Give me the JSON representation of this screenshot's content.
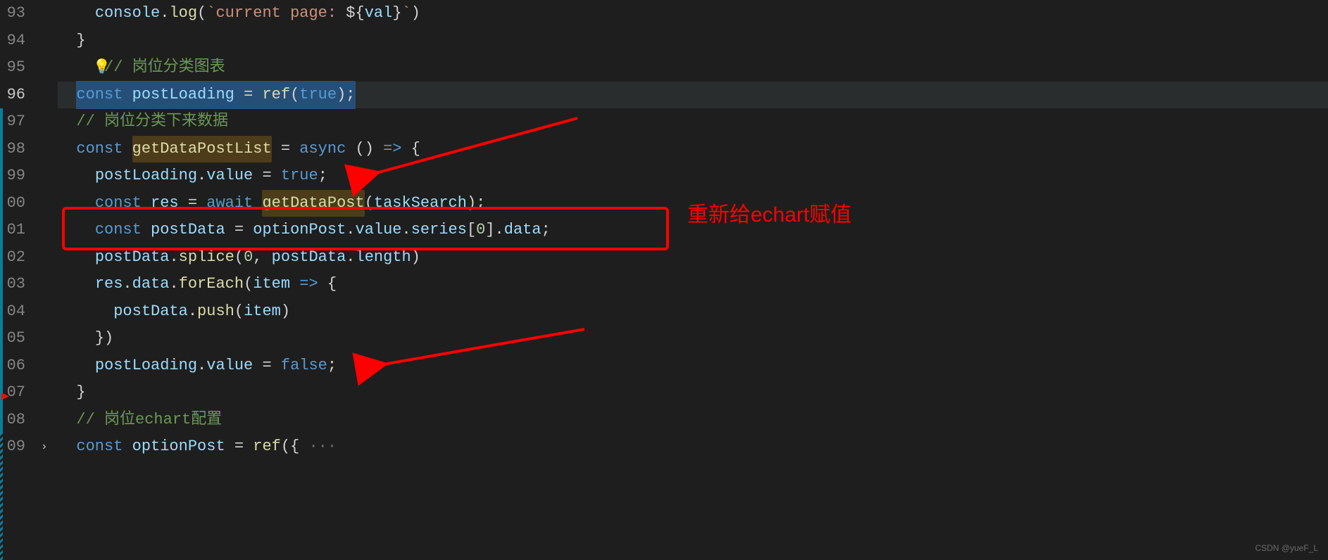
{
  "line_numbers": [
    "93",
    "94",
    "95",
    "96",
    "97",
    "98",
    "99",
    "00",
    "01",
    "02",
    "03",
    "04",
    "05",
    "06",
    "07",
    "08",
    "09"
  ],
  "active_line_index": 3,
  "bulb_line_index": 2,
  "fold_line_index": 16,
  "breakpoint_caret_line_index": 14,
  "code": {
    "l93": {
      "indent": "    ",
      "tokens": [
        {
          "t": "console",
          "c": "tk-var"
        },
        {
          "t": ".",
          "c": "tk-pun"
        },
        {
          "t": "log",
          "c": "tk-call"
        },
        {
          "t": "(",
          "c": "tk-pun"
        },
        {
          "t": "`current page: ",
          "c": "tk-str"
        },
        {
          "t": "${",
          "c": "tk-pun"
        },
        {
          "t": "val",
          "c": "tk-var"
        },
        {
          "t": "}",
          "c": "tk-pun"
        },
        {
          "t": "`",
          "c": "tk-str"
        },
        {
          "t": ")",
          "c": "tk-pun"
        }
      ]
    },
    "l94": {
      "indent": "  ",
      "tokens": [
        {
          "t": "}",
          "c": "tk-pun"
        }
      ]
    },
    "l95": {
      "indent": "  ",
      "tokens": [
        {
          "t": "// 岗位分类图表",
          "c": "tk-cmt"
        }
      ]
    },
    "l96_raw": "const postLoading = ref(true);",
    "l97": {
      "indent": "  ",
      "tokens": [
        {
          "t": "// 岗位分类下来数据",
          "c": "tk-cmt"
        }
      ]
    },
    "l98": {
      "indent": "  ",
      "tokens": [
        {
          "t": "const ",
          "c": "tk-kw"
        },
        {
          "t": "getDataPostList",
          "c": "tk-call ref-hl"
        },
        {
          "t": " = ",
          "c": "tk-op"
        },
        {
          "t": "async",
          "c": "tk-kw"
        },
        {
          "t": " () ",
          "c": "tk-pun"
        },
        {
          "t": "=>",
          "c": "tk-kw"
        },
        {
          "t": " {",
          "c": "tk-pun"
        }
      ]
    },
    "l99": {
      "indent": "    ",
      "tokens": [
        {
          "t": "postLoading",
          "c": "tk-var"
        },
        {
          "t": ".",
          "c": "tk-pun"
        },
        {
          "t": "value",
          "c": "tk-prop"
        },
        {
          "t": " = ",
          "c": "tk-op"
        },
        {
          "t": "true",
          "c": "tk-const"
        },
        {
          "t": ";",
          "c": "tk-pun"
        }
      ]
    },
    "l00": {
      "indent": "    ",
      "tokens": [
        {
          "t": "const ",
          "c": "tk-kw"
        },
        {
          "t": "res",
          "c": "tk-var"
        },
        {
          "t": " = ",
          "c": "tk-op"
        },
        {
          "t": "await ",
          "c": "tk-kw"
        },
        {
          "t": "getDataPost",
          "c": "tk-call ref-hl"
        },
        {
          "t": "(",
          "c": "tk-pun"
        },
        {
          "t": "taskSearch",
          "c": "tk-var"
        },
        {
          "t": ");",
          "c": "tk-pun"
        }
      ]
    },
    "l01": {
      "indent": "    ",
      "tokens": [
        {
          "t": "const ",
          "c": "tk-kw"
        },
        {
          "t": "postData",
          "c": "tk-var"
        },
        {
          "t": " = ",
          "c": "tk-op"
        },
        {
          "t": "optionPost",
          "c": "tk-var"
        },
        {
          "t": ".",
          "c": "tk-pun"
        },
        {
          "t": "value",
          "c": "tk-prop"
        },
        {
          "t": ".",
          "c": "tk-pun"
        },
        {
          "t": "series",
          "c": "tk-prop"
        },
        {
          "t": "[",
          "c": "tk-pun"
        },
        {
          "t": "0",
          "c": "tk-index"
        },
        {
          "t": "].",
          "c": "tk-pun"
        },
        {
          "t": "data",
          "c": "tk-prop"
        },
        {
          "t": ";",
          "c": "tk-pun"
        }
      ]
    },
    "l02": {
      "indent": "    ",
      "tokens": [
        {
          "t": "postData",
          "c": "tk-var"
        },
        {
          "t": ".",
          "c": "tk-pun"
        },
        {
          "t": "splice",
          "c": "tk-call"
        },
        {
          "t": "(",
          "c": "tk-pun"
        },
        {
          "t": "0",
          "c": "tk-num"
        },
        {
          "t": ", ",
          "c": "tk-pun"
        },
        {
          "t": "postData",
          "c": "tk-var"
        },
        {
          "t": ".",
          "c": "tk-pun"
        },
        {
          "t": "length",
          "c": "tk-prop"
        },
        {
          "t": ")",
          "c": "tk-pun"
        }
      ]
    },
    "l03": {
      "indent": "    ",
      "tokens": [
        {
          "t": "res",
          "c": "tk-var"
        },
        {
          "t": ".",
          "c": "tk-pun"
        },
        {
          "t": "data",
          "c": "tk-prop"
        },
        {
          "t": ".",
          "c": "tk-pun"
        },
        {
          "t": "forEach",
          "c": "tk-call"
        },
        {
          "t": "(",
          "c": "tk-pun"
        },
        {
          "t": "item",
          "c": "tk-param"
        },
        {
          "t": " => ",
          "c": "tk-kw"
        },
        {
          "t": "{",
          "c": "tk-pun"
        }
      ]
    },
    "l04": {
      "indent": "      ",
      "tokens": [
        {
          "t": "postData",
          "c": "tk-var"
        },
        {
          "t": ".",
          "c": "tk-pun"
        },
        {
          "t": "push",
          "c": "tk-call"
        },
        {
          "t": "(",
          "c": "tk-pun"
        },
        {
          "t": "item",
          "c": "tk-var"
        },
        {
          "t": ")",
          "c": "tk-pun"
        }
      ]
    },
    "l05": {
      "indent": "    ",
      "tokens": [
        {
          "t": "})",
          "c": "tk-pun"
        }
      ]
    },
    "l06": {
      "indent": "    ",
      "tokens": [
        {
          "t": "postLoading",
          "c": "tk-var"
        },
        {
          "t": ".",
          "c": "tk-pun"
        },
        {
          "t": "value",
          "c": "tk-prop"
        },
        {
          "t": " = ",
          "c": "tk-op"
        },
        {
          "t": "false",
          "c": "tk-const"
        },
        {
          "t": ";",
          "c": "tk-pun"
        }
      ]
    },
    "l07": {
      "indent": "  ",
      "tokens": [
        {
          "t": "}",
          "c": "tk-pun"
        }
      ]
    },
    "l08": {
      "indent": "  ",
      "tokens": [
        {
          "t": "// 岗位echart配置",
          "c": "tk-cmt"
        }
      ]
    },
    "l09": {
      "indent": "  ",
      "tokens": [
        {
          "t": "const ",
          "c": "tk-kw"
        },
        {
          "t": "optionPost",
          "c": "tk-var"
        },
        {
          "t": " = ",
          "c": "tk-op"
        },
        {
          "t": "ref",
          "c": "tk-call"
        },
        {
          "t": "({",
          "c": "tk-pun"
        },
        {
          "t": " ···",
          "c": "tk-dots"
        }
      ]
    }
  },
  "annotation": {
    "label": "重新给echart赋值"
  },
  "watermark": "CSDN @yueF_L"
}
